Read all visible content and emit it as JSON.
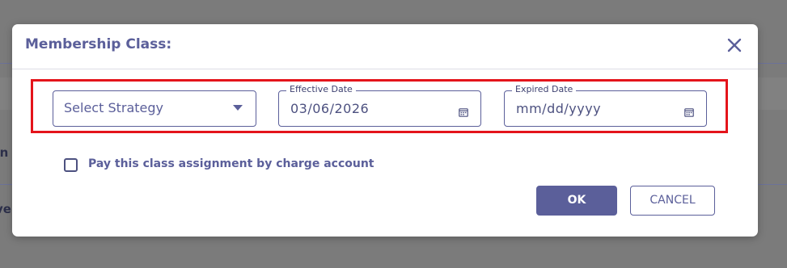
{
  "background": {
    "fragments": [
      "In",
      "ve"
    ]
  },
  "dialog": {
    "title": "Membership Class:",
    "close_icon": "close-icon"
  },
  "form": {
    "strategy": {
      "value": "Select Strategy",
      "icon": "chevron-down-icon"
    },
    "effective_date": {
      "label": "Effective Date",
      "value": "03/06/2026",
      "icon": "calendar-icon"
    },
    "expired_date": {
      "label": "Expired Date",
      "value": "mm/dd/yyyy",
      "icon": "calendar-icon"
    },
    "charge_account": {
      "label": "Pay this class assignment by charge account",
      "checked": false
    }
  },
  "buttons": {
    "ok": "OK",
    "cancel": "CANCEL"
  },
  "colors": {
    "accent": "#5b5f9a",
    "highlight": "#e4141b",
    "overlay": "#7b7b7b"
  }
}
